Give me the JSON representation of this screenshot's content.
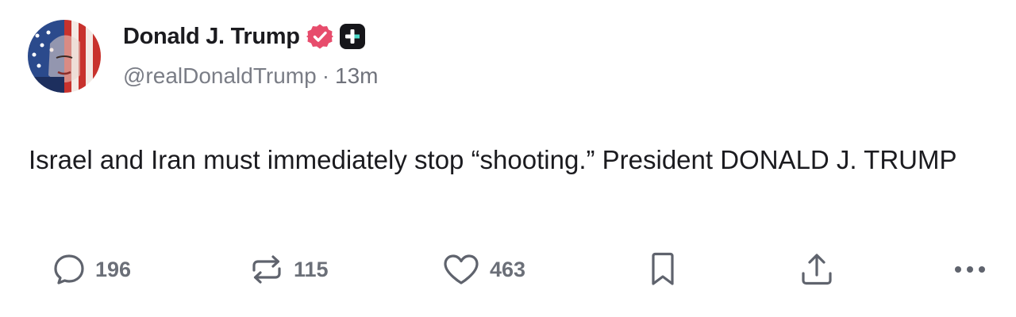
{
  "author": {
    "display_name": "Donald J. Trump",
    "handle": "@realDonaldTrump",
    "separator": "·",
    "time_ago": "13m",
    "avatar_icon": "flag-portrait-avatar",
    "verified_icon": "verified-badge-icon",
    "verified_color": "#e74c6c",
    "plus_badge_icon": "plus-badge-icon"
  },
  "post": {
    "text": "Israel and Iran must immediately stop “shooting.” President DONALD J. TRUMP"
  },
  "actions": {
    "reply": {
      "icon": "comment-icon",
      "count": "196"
    },
    "retruth": {
      "icon": "repost-icon",
      "count": "115"
    },
    "like": {
      "icon": "heart-icon",
      "count": "463"
    },
    "bookmark": {
      "icon": "bookmark-icon"
    },
    "share": {
      "icon": "share-icon"
    },
    "more": {
      "icon": "more-icon"
    }
  },
  "colors": {
    "text": "#1b1b1f",
    "muted": "#7a7d86",
    "icon": "#5f636d",
    "badge": "#e74c6c"
  }
}
